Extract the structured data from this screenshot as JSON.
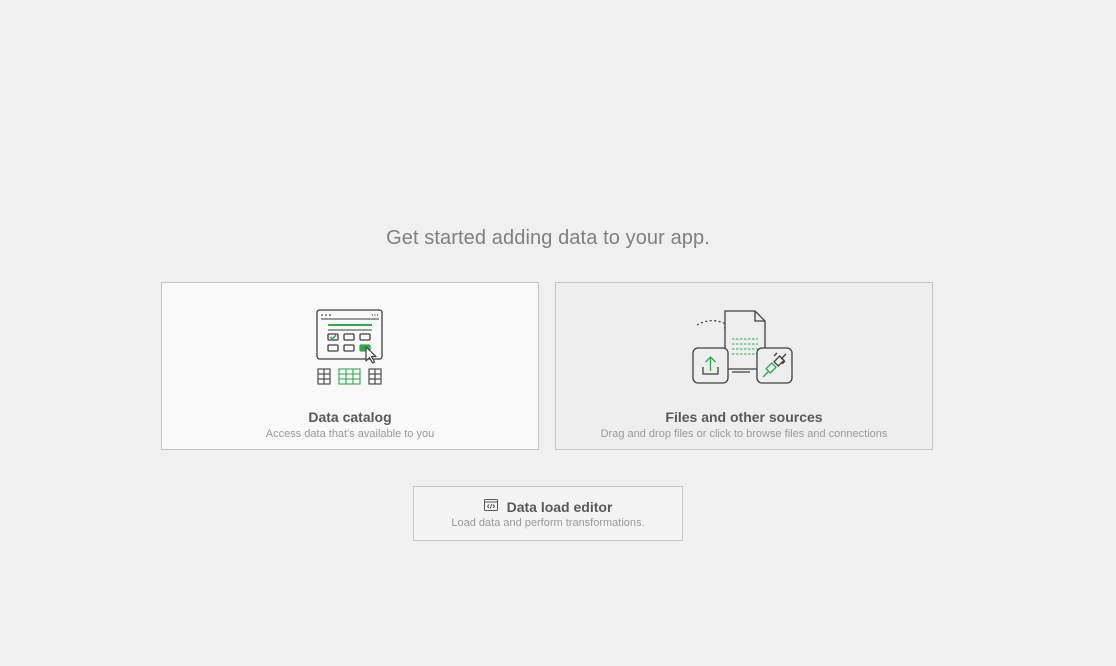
{
  "headline": "Get started adding data to your app.",
  "cards": [
    {
      "title": "Data catalog",
      "description": "Access data that's available to you",
      "icon": "data-catalog-icon"
    },
    {
      "title": "Files and other sources",
      "description": "Drag and drop files or click to browse files and connections",
      "icon": "files-sources-icon"
    }
  ],
  "editor": {
    "title": "Data load editor",
    "description": "Load data and perform transformations.",
    "icon": "script-editor-icon"
  },
  "colors": {
    "background": "#f0f0f0",
    "accent": "#2fa84f",
    "icon_stroke": "#404040",
    "title_text": "#595959",
    "muted_text": "#9a9a9a"
  }
}
